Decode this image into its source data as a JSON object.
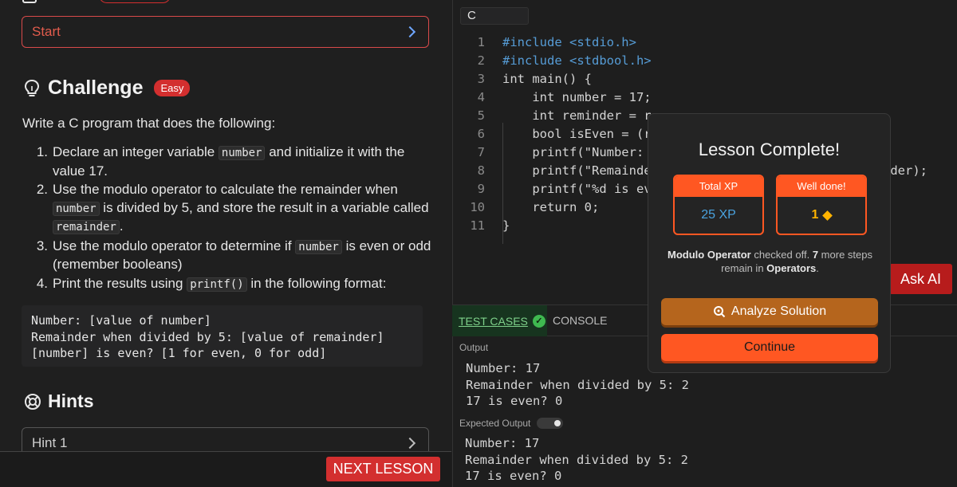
{
  "left": {
    "start_label": "Start",
    "challenge": {
      "title": "Challenge",
      "difficulty": "Easy"
    },
    "intro": "Write a C program that does the following:",
    "steps": [
      {
        "num": "1.",
        "parts": [
          "Declare an integer variable ",
          "number",
          " and initialize it with the value 17."
        ]
      },
      {
        "num": "2.",
        "parts": [
          "Use the modulo operator to calculate the remainder when ",
          "number",
          " is divided by 5, and store the result in a variable called ",
          "remainder",
          "."
        ]
      },
      {
        "num": "3.",
        "parts": [
          "Use the modulo operator to determine if ",
          "number",
          " is even or odd (remember booleans)"
        ]
      },
      {
        "num": "4.",
        "parts": [
          "Print the results using ",
          "printf()",
          " in the following format:"
        ]
      }
    ],
    "format_lines": [
      "Number: [value of number]",
      "Remainder when divided by 5: [value of remainder]",
      "[number] is even? [1 for even, 0 for odd]"
    ],
    "hints_title": "Hints",
    "hint1_label": "Hint 1",
    "next_lesson": "NEXT LESSON"
  },
  "editor": {
    "language": "C",
    "lines": [
      "#include <stdio.h>",
      "#include <stdbool.h>",
      "int main() {",
      "    int number = 17;",
      "    int reminder = r",
      "    bool isEven = (r",
      "    printf(\"Number: ",
      "    printf(\"Remainde",
      "    printf(\"%d is ev",
      "    return 0;",
      "}"
    ],
    "line8_tail": "nder);"
  },
  "ask_ai": "Ask AI",
  "tabs": {
    "test_cases": "TEST CASES",
    "console": "CONSOLE"
  },
  "output": {
    "label": "Output",
    "lines": [
      "Number: 17",
      "Remainder when divided by 5: 2",
      "17 is even? 0"
    ]
  },
  "expected": {
    "label": "Expected Output",
    "lines": [
      "Number: 17",
      "Remainder when divided by 5: 2",
      "17 is even? 0"
    ]
  },
  "modal": {
    "title": "Lesson Complete!",
    "xp_label": "Total XP",
    "xp_value": "25 XP",
    "done_label": "Well done!",
    "done_value": "1",
    "msg_topic": "Modulo Operator",
    "msg_mid1": " checked off. ",
    "msg_count": "7",
    "msg_mid2": " more steps remain in ",
    "msg_section": "Operators",
    "msg_end": ".",
    "analyze_label": "Analyze Solution",
    "continue_label": "Continue"
  },
  "colors": {
    "accent_red": "#d32f2f",
    "accent_orange": "#ff5722",
    "analyze_brown": "#b5651d",
    "pass_green": "#3fb950"
  }
}
